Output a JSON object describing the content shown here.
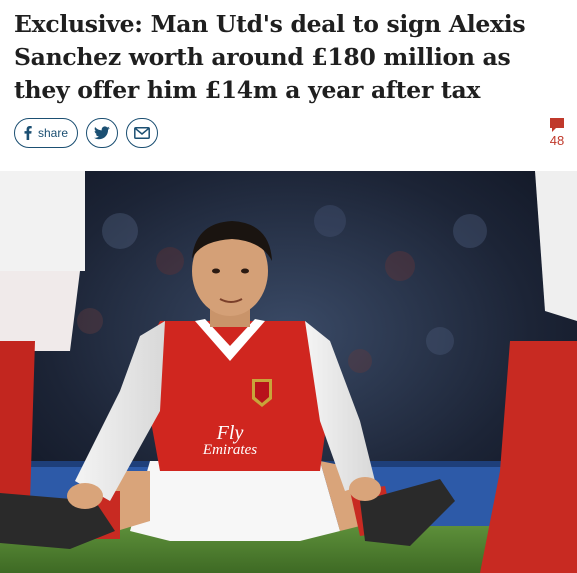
{
  "article": {
    "headline": "Exclusive: Man Utd's deal to sign Alexis Sanchez worth around £180 million as they offer him £14m a year after tax"
  },
  "share": {
    "facebook_label": "share",
    "facebook_icon": "facebook-icon",
    "twitter_icon": "twitter-icon",
    "email_icon": "email-icon",
    "brand_color": "#1b4f72"
  },
  "comments": {
    "icon": "comment-icon",
    "count": "48",
    "color": "#c0392b"
  },
  "image": {
    "shirt_sponsor_line1": "Fly",
    "shirt_sponsor_line2": "Emirates"
  }
}
